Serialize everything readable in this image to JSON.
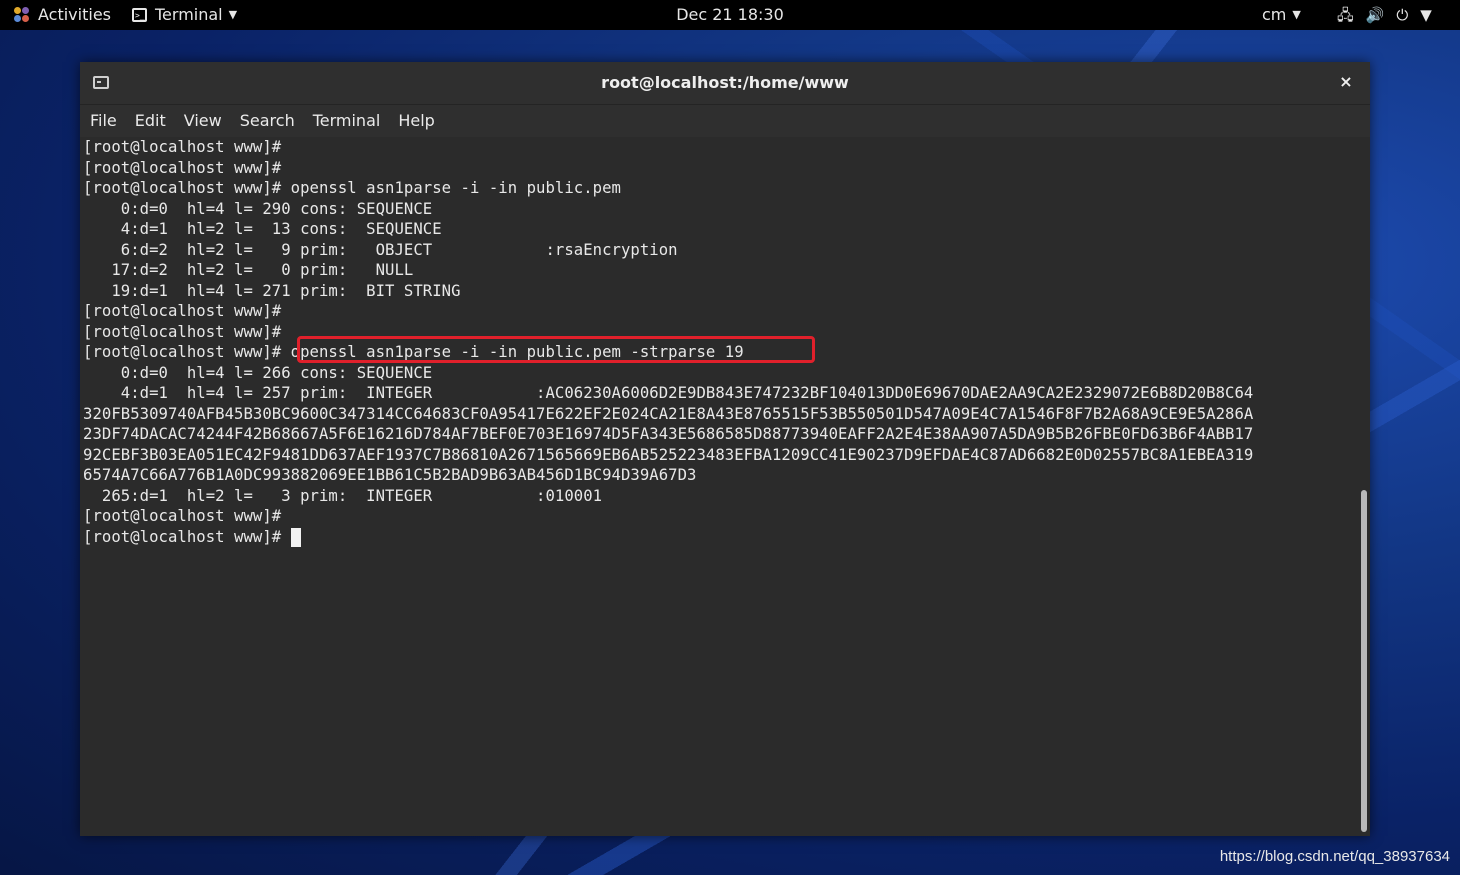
{
  "topbar": {
    "activities": "Activities",
    "app_name": "Terminal",
    "clock": "Dec 21  18:30",
    "input_source": "cm"
  },
  "window": {
    "title": "root@localhost:/home/www",
    "close": "×",
    "menu": [
      "File",
      "Edit",
      "View",
      "Search",
      "Terminal",
      "Help"
    ]
  },
  "terminal": {
    "lines": [
      "[root@localhost www]#",
      "[root@localhost www]#",
      "[root@localhost www]# openssl asn1parse -i -in public.pem",
      "    0:d=0  hl=4 l= 290 cons: SEQUENCE",
      "    4:d=1  hl=2 l=  13 cons:  SEQUENCE",
      "    6:d=2  hl=2 l=   9 prim:   OBJECT            :rsaEncryption",
      "   17:d=2  hl=2 l=   0 prim:   NULL",
      "   19:d=1  hl=4 l= 271 prim:  BIT STRING",
      "[root@localhost www]#",
      "[root@localhost www]#",
      "[root@localhost www]# openssl asn1parse -i -in public.pem -strparse 19",
      "    0:d=0  hl=4 l= 266 cons: SEQUENCE",
      "    4:d=1  hl=4 l= 257 prim:  INTEGER           :AC06230A6006D2E9DB843E747232BF104013DD0E69670DAE2AA9CA2E2329072E6B8D20B8C64",
      "320FB5309740AFB45B30BC9600C347314CC64683CF0A95417E622EF2E024CA21E8A43E8765515F53B550501D547A09E4C7A1546F8F7B2A68A9CE9E5A286A",
      "23DF74DACAC74244F42B68667A5F6E16216D784AF7BEF0E703E16974D5FA343E5686585D88773940EAFF2A2E4E38AA907A5DA9B5B26FBE0FD63B6F4ABB17",
      "92CEBF3B03EA051EC42F9481DD637AEF1937C7B86810A2671565669EB6AB525223483EFBA1209CC41E90237D9EFDAE4C87AD6682E0D02557BC8A1EBEA319",
      "6574A7C66A776B1A0DC993882069EE1BB61C5B2BAD9B63AB456D1BC94D39A67D3",
      "  265:d=1  hl=2 l=   3 prim:  INTEGER           :010001",
      "[root@localhost www]#",
      "[root@localhost www]# "
    ]
  },
  "watermark": "https://blog.csdn.net/qq_38937634"
}
